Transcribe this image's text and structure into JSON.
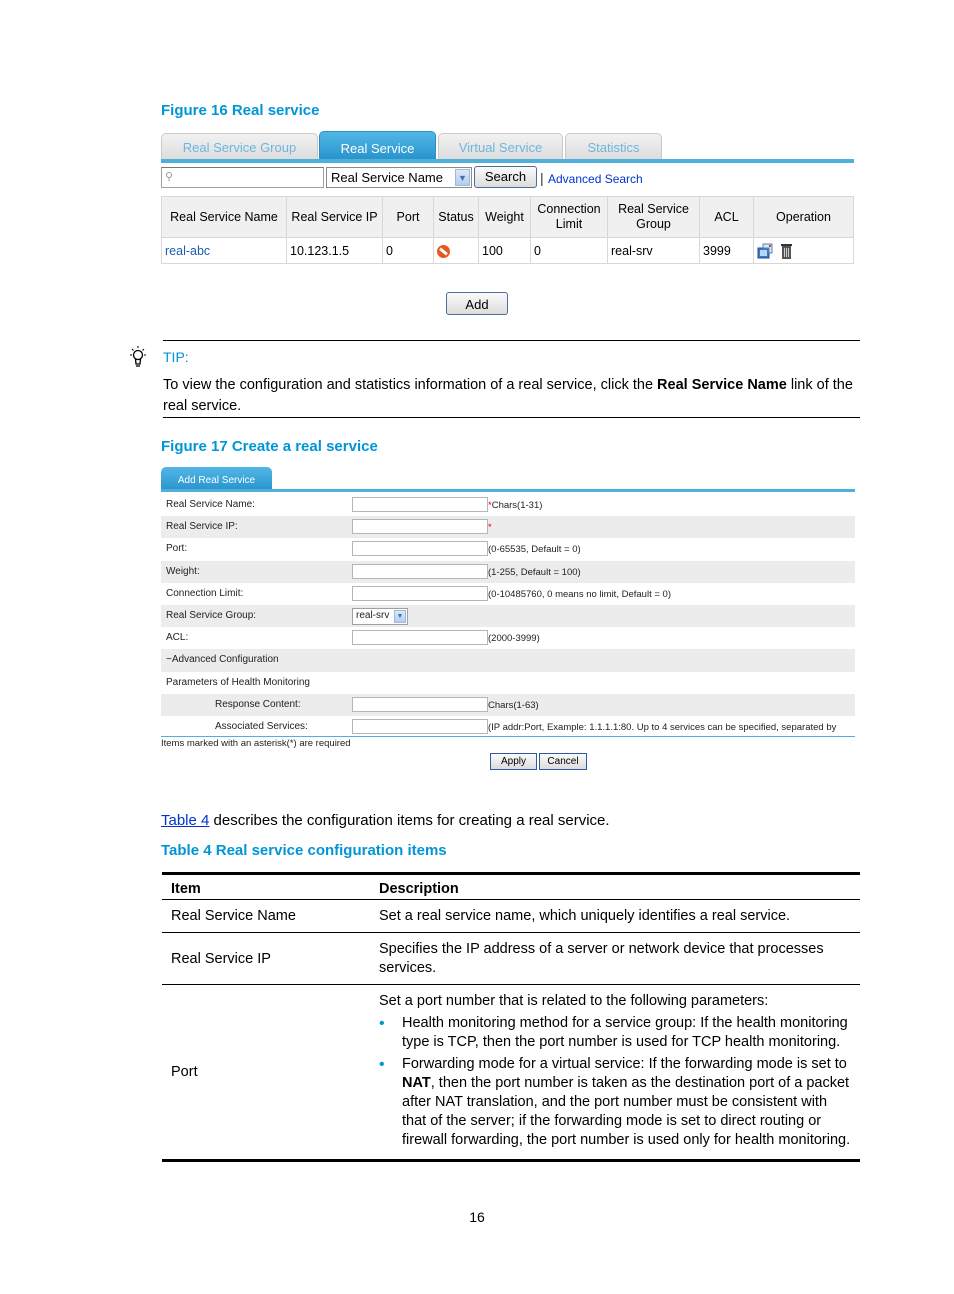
{
  "figure16": {
    "caption": "Figure 16 Real service",
    "tabs": [
      {
        "label": "Real Service Group",
        "active": false
      },
      {
        "label": "Real Service",
        "active": true
      },
      {
        "label": "Virtual Service",
        "active": false
      },
      {
        "label": "Statistics",
        "active": false
      }
    ],
    "search": {
      "input_value": "",
      "field_select": "Real Service Name",
      "search_button": "Search",
      "advanced_link": "Advanced Search"
    },
    "table": {
      "headers": [
        "Real Service Name",
        "Real Service IP",
        "Port",
        "Status",
        "Weight",
        "Connection Limit",
        "Real Service Group",
        "ACL",
        "Operation"
      ],
      "rows": [
        {
          "name": "real-abc",
          "ip": "10.123.1.5",
          "port": "0",
          "status_icon": "stop-icon",
          "weight": "100",
          "connection_limit": "0",
          "group": "real-srv",
          "acl": "3999",
          "operations": [
            "edit-icon",
            "trash-icon"
          ]
        }
      ]
    },
    "add_button": "Add"
  },
  "tip": {
    "label": "TIP:",
    "text_before": "To view the configuration and statistics information of a real service, click the ",
    "text_bold": "Real Service Name",
    "text_after": " link of the real service."
  },
  "figure17": {
    "caption": "Figure 17 Create a real service",
    "tab_label": "Add Real Service",
    "fields": [
      {
        "label": "Real Service Name:",
        "value": "",
        "required": true,
        "hint": "Chars(1-31)"
      },
      {
        "label": "Real Service IP:",
        "value": "",
        "required": true,
        "hint": ""
      },
      {
        "label": "Port:",
        "value": "",
        "required": false,
        "hint": "(0-65535, Default = 0)"
      },
      {
        "label": "Weight:",
        "value": "",
        "required": false,
        "hint": "(1-255, Default = 100)"
      },
      {
        "label": "Connection Limit:",
        "value": "",
        "required": false,
        "hint": "(0-10485760, 0 means no limit, Default = 0)"
      },
      {
        "label": "Real Service Group:",
        "select_value": "real-srv"
      },
      {
        "label": "ACL:",
        "value": "",
        "required": false,
        "hint": "(2000-3999)"
      }
    ],
    "advanced_section": "−Advanced Configuration",
    "health_section": "Parameters of Health Monitoring",
    "health_fields": [
      {
        "label": "Response Content:",
        "value": "",
        "hint": "Chars(1-63)"
      },
      {
        "label": "Associated Services:",
        "value": "",
        "hint": "(IP addr:Port, Example: 1.1.1.1:80. Up to 4 services can be specified, separated by"
      }
    ],
    "required_note": "Items marked with an asterisk(*) are required",
    "apply_button": "Apply",
    "cancel_button": "Cancel",
    "asterisk": "*"
  },
  "table4_intro": {
    "link": "Table 4",
    "text": " describes the configuration items for creating a real service."
  },
  "table4": {
    "caption": "Table 4 Real service configuration items",
    "headers": [
      "Item",
      "Description"
    ],
    "rows": [
      {
        "item": "Real Service Name",
        "description": "Set a real service name, which uniquely identifies a real service."
      },
      {
        "item": "Real Service IP",
        "description": "Specifies the IP address of a server or network device that processes services."
      },
      {
        "item": "Port",
        "description": "Set a port number that is related to the following parameters:",
        "bullets": [
          {
            "text": "Health monitoring method for a service group: If the health monitoring type is TCP, then the port number is used for TCP health monitoring."
          },
          {
            "text_before": "Forwarding mode for a virtual service: If the forwarding mode is set to ",
            "bold": "NAT",
            "text_after": ", then the port number is taken as the destination port of a packet after NAT translation, and the port number must be consistent with that of the server; if the forwarding mode is set to direct routing or firewall forwarding, the port number is used only for health monitoring."
          }
        ]
      }
    ]
  },
  "page_number": "16",
  "colors": {
    "accent": "#0096d6",
    "tab_active": "#2793cc",
    "link": "#1f5bb5",
    "required": "#e00000"
  }
}
